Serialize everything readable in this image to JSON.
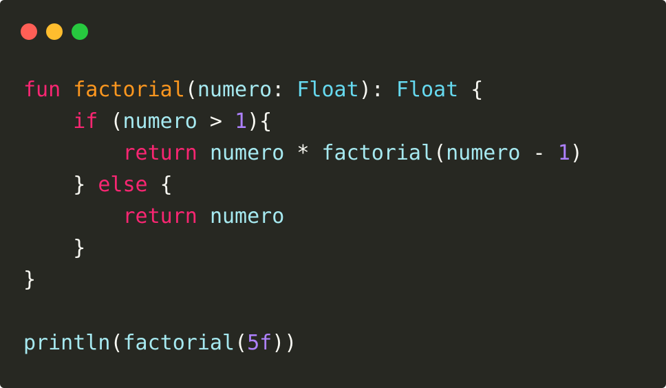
{
  "window": {
    "controls": [
      {
        "name": "close-button",
        "color": "#ff5f56"
      },
      {
        "name": "minimize-button",
        "color": "#ffbd2e"
      },
      {
        "name": "maximize-button",
        "color": "#27c93f"
      }
    ]
  },
  "colors": {
    "background": "#272822",
    "keyword": "#f92672",
    "function": "#fd971f",
    "identifier": "#a6e9f0",
    "type": "#66d9ef",
    "number": "#ae81ff",
    "default": "#f8f8f2"
  },
  "code": {
    "lines": [
      [
        {
          "t": "fun",
          "k": "keyword"
        },
        {
          "t": " ",
          "k": "default"
        },
        {
          "t": "factorial",
          "k": "function"
        },
        {
          "t": "(",
          "k": "default"
        },
        {
          "t": "numero",
          "k": "identifier"
        },
        {
          "t": ": ",
          "k": "default"
        },
        {
          "t": "Float",
          "k": "type"
        },
        {
          "t": "): ",
          "k": "default"
        },
        {
          "t": "Float",
          "k": "type"
        },
        {
          "t": " {",
          "k": "default"
        }
      ],
      [
        {
          "t": "    ",
          "k": "default"
        },
        {
          "t": "if",
          "k": "keyword"
        },
        {
          "t": " (",
          "k": "default"
        },
        {
          "t": "numero",
          "k": "identifier"
        },
        {
          "t": " > ",
          "k": "default"
        },
        {
          "t": "1",
          "k": "number"
        },
        {
          "t": "){",
          "k": "default"
        }
      ],
      [
        {
          "t": "        ",
          "k": "default"
        },
        {
          "t": "return",
          "k": "keyword"
        },
        {
          "t": " ",
          "k": "default"
        },
        {
          "t": "numero",
          "k": "identifier"
        },
        {
          "t": " * ",
          "k": "default"
        },
        {
          "t": "factorial",
          "k": "identifier"
        },
        {
          "t": "(",
          "k": "default"
        },
        {
          "t": "numero",
          "k": "identifier"
        },
        {
          "t": " - ",
          "k": "default"
        },
        {
          "t": "1",
          "k": "number"
        },
        {
          "t": ")",
          "k": "default"
        }
      ],
      [
        {
          "t": "    } ",
          "k": "default"
        },
        {
          "t": "else",
          "k": "keyword"
        },
        {
          "t": " {",
          "k": "default"
        }
      ],
      [
        {
          "t": "        ",
          "k": "default"
        },
        {
          "t": "return",
          "k": "keyword"
        },
        {
          "t": " ",
          "k": "default"
        },
        {
          "t": "numero",
          "k": "identifier"
        }
      ],
      [
        {
          "t": "    }",
          "k": "default"
        }
      ],
      [
        {
          "t": "}",
          "k": "default"
        }
      ],
      [],
      [
        {
          "t": "println",
          "k": "identifier"
        },
        {
          "t": "(",
          "k": "default"
        },
        {
          "t": "factorial",
          "k": "identifier"
        },
        {
          "t": "(",
          "k": "default"
        },
        {
          "t": "5f",
          "k": "number"
        },
        {
          "t": "))",
          "k": "default"
        }
      ]
    ]
  }
}
